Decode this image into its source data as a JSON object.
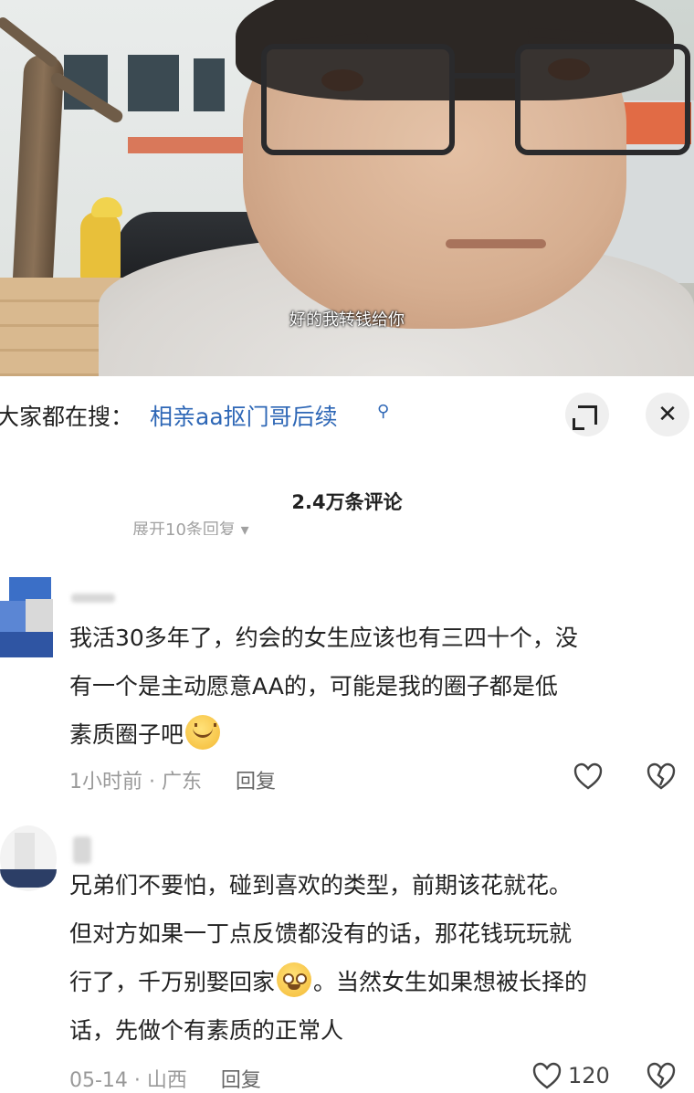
{
  "video": {
    "subtitle": "好的我转钱给你"
  },
  "search": {
    "label": "大家都在搜：",
    "query": "相亲aa抠门哥后续",
    "query_icon": "search-icon"
  },
  "panel": {
    "comment_count": "2.4万条评论",
    "collapsed_replies": "展开10条回复"
  },
  "comments": [
    {
      "lines": [
        "我活30多年了，约会的女生应该也有三四十个，没",
        "有一个是主动愿意AA的，可能是我的圈子都是低",
        "素质圈子吧"
      ],
      "emoji": "grinning-sweat",
      "time": "1小时前 · 广东",
      "reply_label": "回复",
      "likes": ""
    },
    {
      "lines": [
        "兄弟们不要怕，碰到喜欢的类型，前期该花就花。",
        "但对方如果一丁点反馈都没有的话，那花钱玩玩就",
        "行了，千万别娶回家",
        "。当然女生如果想被长择的",
        "话，先做个有素质的正常人"
      ],
      "emoji": "smiling",
      "time": "05-14 · 山西",
      "reply_label": "回复",
      "likes": "120"
    }
  ],
  "colors": {
    "link_blue": "#2e67b6",
    "meta_gray": "#999999",
    "text": "#222222"
  }
}
